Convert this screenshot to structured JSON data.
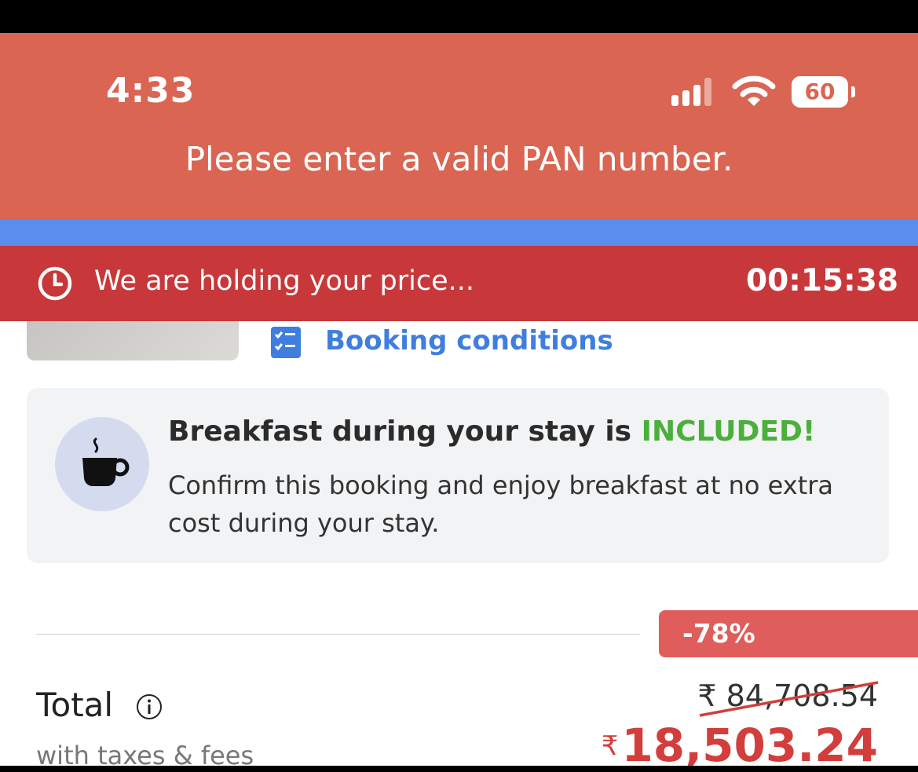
{
  "status_bar": {
    "time": "4:33",
    "battery": "60"
  },
  "toast": {
    "message": "Please enter a valid PAN number."
  },
  "hold_bar": {
    "text": "We are holding your price...",
    "timer": "00:15:38"
  },
  "booking": {
    "conditions_label": "Booking conditions"
  },
  "breakfast": {
    "title": "Breakfast during your stay is ",
    "highlight": "INCLUDED!",
    "description": "Confirm this booking and enjoy breakfast at no extra cost during your stay."
  },
  "pricing": {
    "discount": "-78%",
    "total_label": "Total",
    "taxes_note": "with taxes & fees",
    "original_price": "₹ 84,708.54",
    "currency_symbol": "₹",
    "final_price": "18,503.24"
  },
  "colors": {
    "toast_bg": "#d96552",
    "hold_bar_bg": "#c8383a",
    "accent_blue": "#3f7ede",
    "included_green": "#4caf3c",
    "price_red": "#d23e3b"
  },
  "icons": [
    "signal-icon",
    "wifi-icon",
    "battery-icon",
    "clock-icon",
    "checklist-icon",
    "coffee-cup-icon",
    "info-icon"
  ]
}
